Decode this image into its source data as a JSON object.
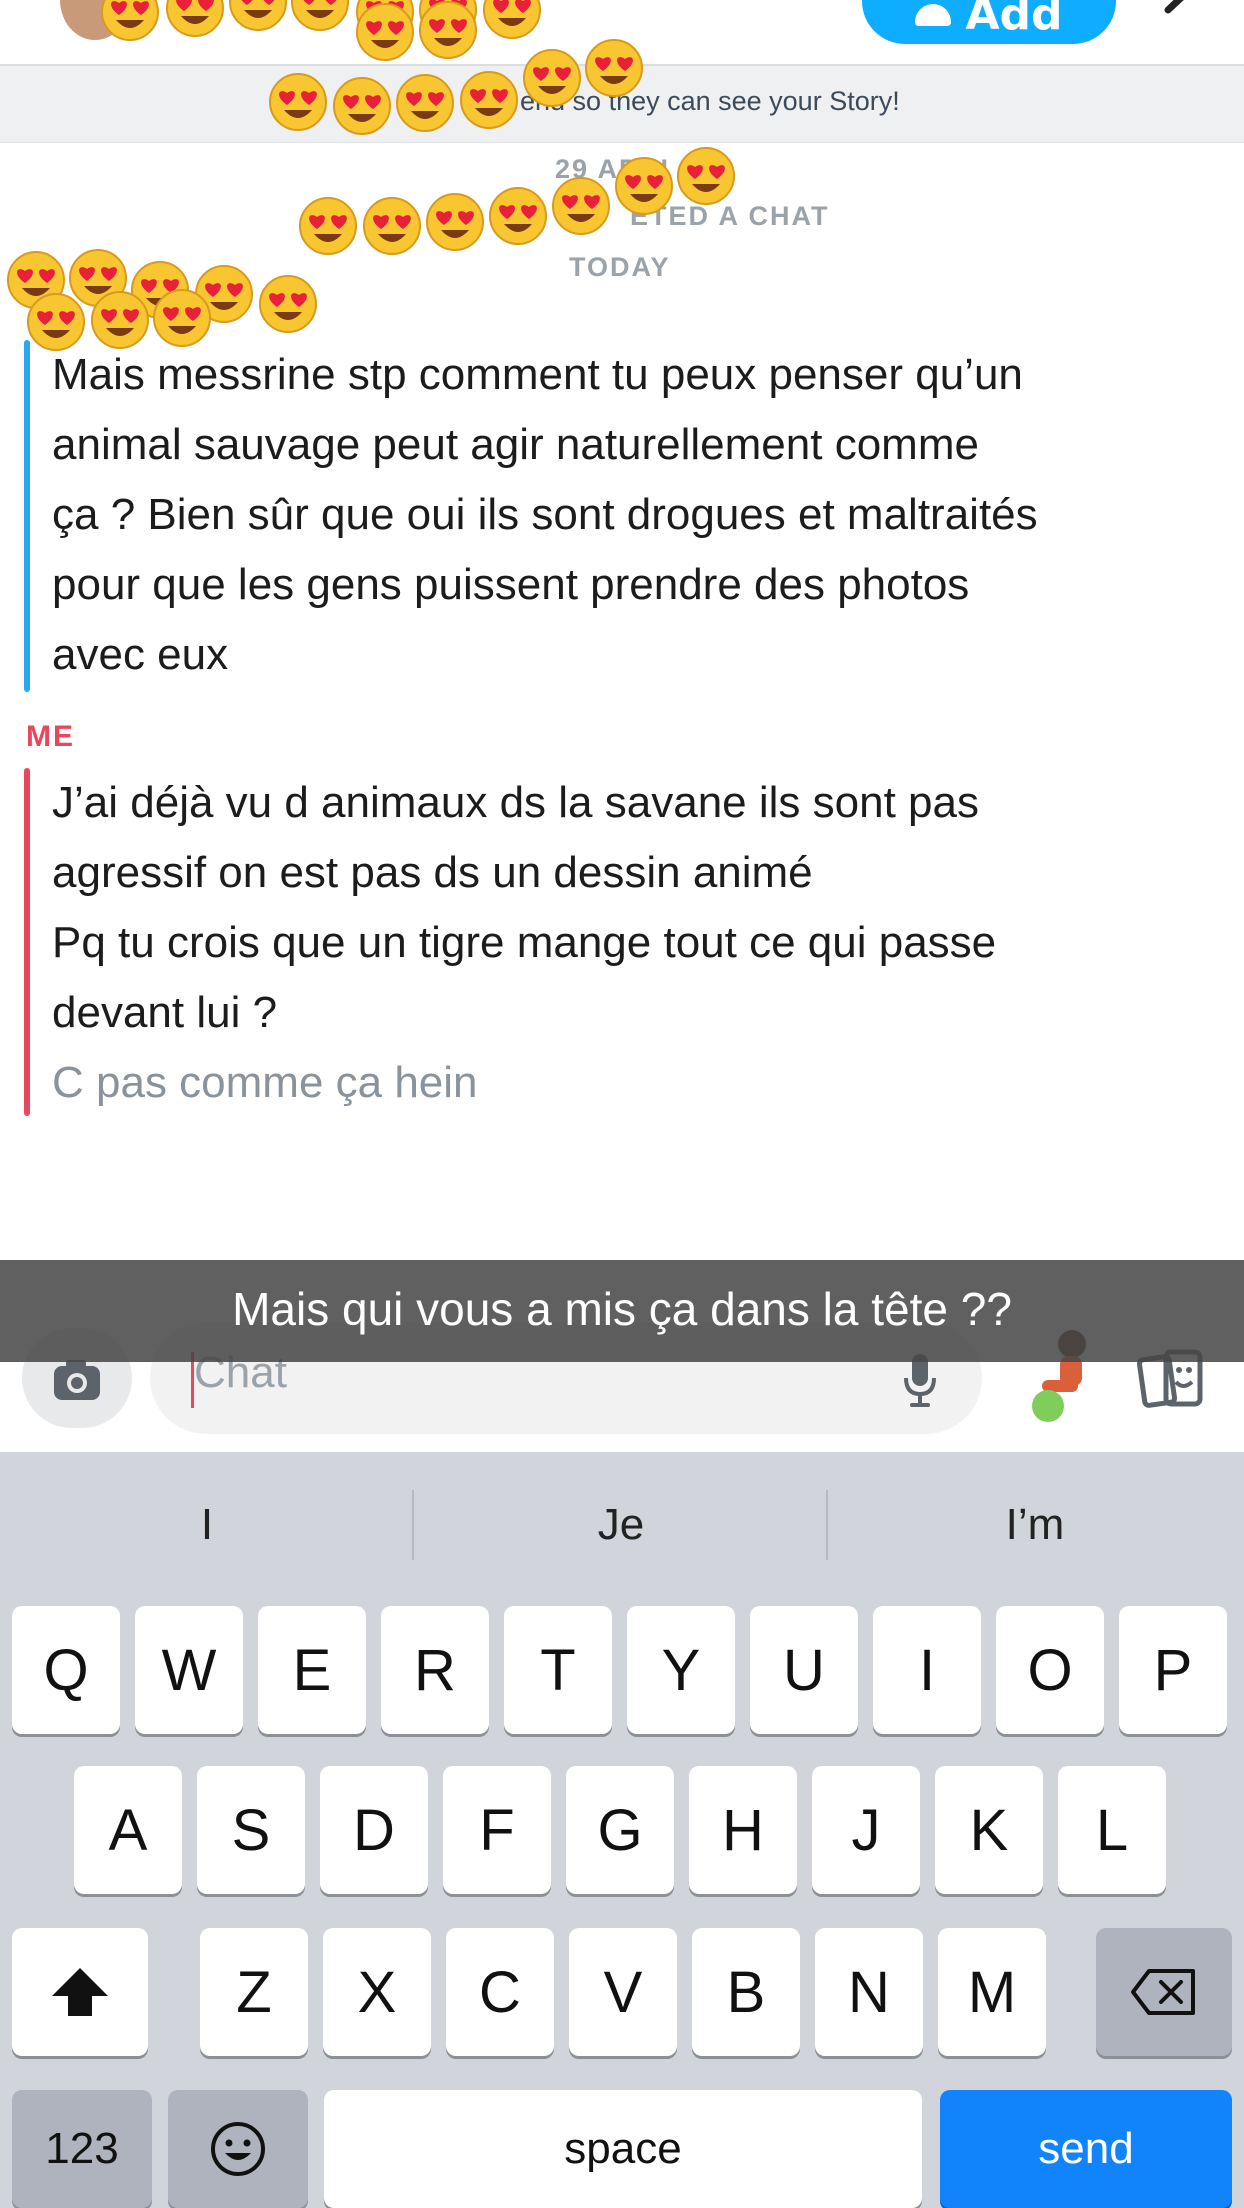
{
  "header": {
    "add_button_label": "Add",
    "add_icon": "add-friend-icon",
    "avatar": "avatar",
    "more_icon": "pencil-icon"
  },
  "banner": {
    "text": "end so they can see your Story!"
  },
  "system": {
    "date": "29 APRI",
    "deleted": "ETED A CHAT",
    "today": "TODAY"
  },
  "messages": {
    "friend": {
      "lines": [
        "Mais messrine stp comment tu peux penser qu’un",
        "animal sauvage peut agir naturellement comme",
        "ça ? Bien sûr que oui ils sont drogues et maltraités",
        "pour que les gens puissent prendre des photos",
        "avec eux"
      ],
      "accent_color": "#2aa7f0"
    },
    "me": {
      "sender": "ME",
      "lines": [
        "J’ai déjà vu d animaux ds la savane ils sont pas",
        "agressif on est pas ds un dessin animé",
        "Pq tu crois que un tigre mange tout ce qui passe",
        "devant lui ?"
      ],
      "pending_line": "C pas comme ça hein",
      "accent_color": "#e9475c"
    }
  },
  "caption": "Mais qui vous a mis ça dans la tête ??",
  "chat_input": {
    "placeholder": "Chat",
    "camera_icon": "camera-icon",
    "mic_icon": "microphone-icon",
    "stickers_icon": "stickers-icon"
  },
  "keyboard": {
    "suggestions": [
      "I",
      "Je",
      "I’m"
    ],
    "row1": [
      "Q",
      "W",
      "E",
      "R",
      "T",
      "Y",
      "U",
      "I",
      "O",
      "P"
    ],
    "row2": [
      "A",
      "S",
      "D",
      "F",
      "G",
      "H",
      "J",
      "K",
      "L"
    ],
    "row3": [
      "Z",
      "X",
      "C",
      "V",
      "B",
      "N",
      "M"
    ],
    "numbers_label": "123",
    "space_label": "space",
    "send_label": "send",
    "shift_icon": "shift-icon",
    "backspace_icon": "backspace-icon",
    "emoji_icon": "emoji-icon",
    "send_color": "#1184fb"
  },
  "emoji_stickers": "heart-eyes-emoji"
}
